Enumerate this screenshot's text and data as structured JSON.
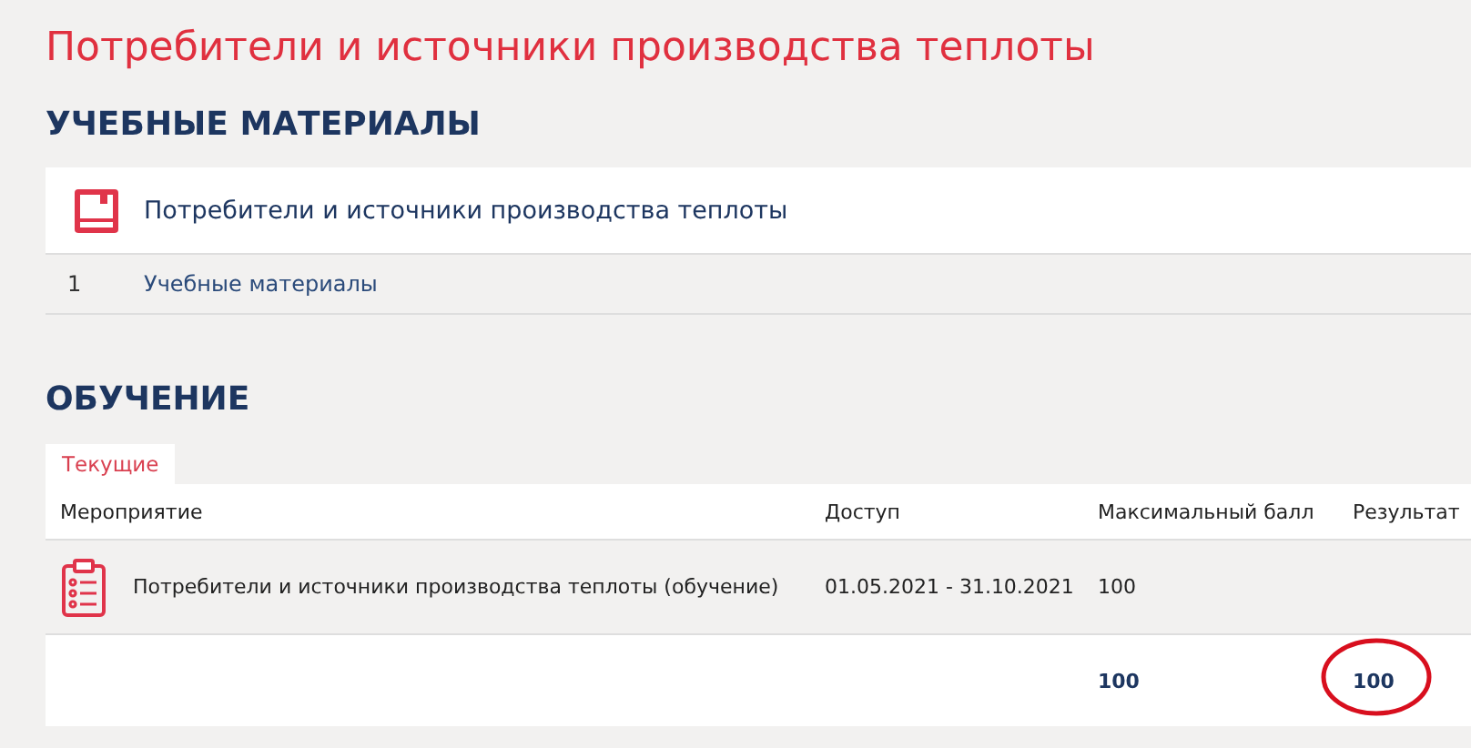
{
  "page_title": "Потребители и источники производства теплоты",
  "materials": {
    "heading": "УЧЕБНЫЕ МАТЕРИАЛЫ",
    "course_title": "Потребители и источники производства теплоты",
    "items": [
      {
        "number": "1",
        "label": "Учебные материалы"
      }
    ]
  },
  "learning": {
    "heading": "ОБУЧЕНИЕ",
    "tabs": [
      {
        "label": "Текущие",
        "selected": true
      }
    ],
    "columns": [
      "Мероприятие",
      "Доступ",
      "Максимальный балл",
      "Результат"
    ],
    "rows": [
      {
        "activity": "Потребители и источники производства теплоты (обучение)",
        "access": "01.05.2021 - 31.10.2021",
        "max_score": "100",
        "result": ""
      }
    ],
    "totals": {
      "max_score": "100",
      "result": "100",
      "circled": true
    }
  }
}
